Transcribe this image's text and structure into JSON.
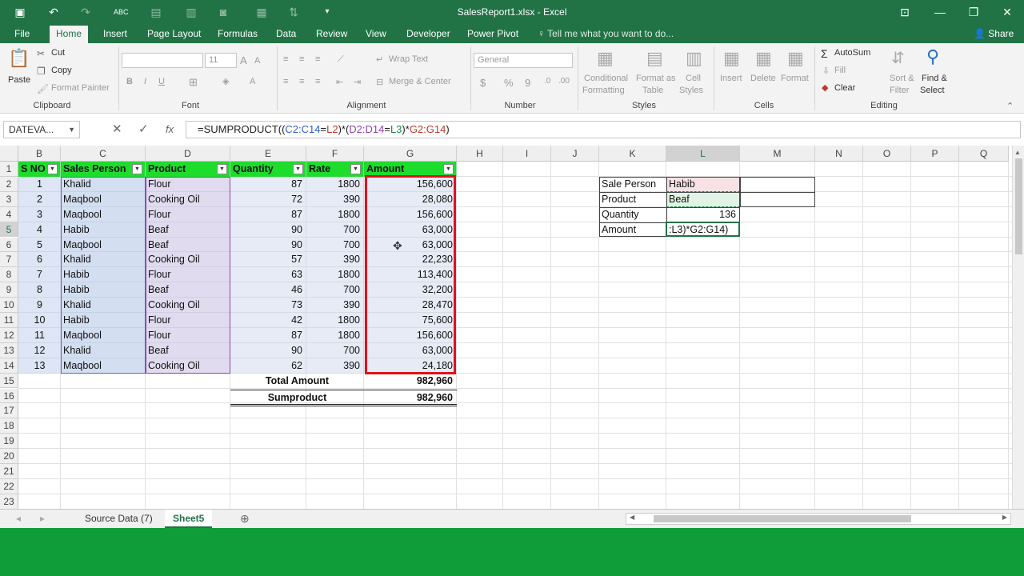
{
  "window": {
    "title": "SalesReport1.xlsx - Excel"
  },
  "tabs": [
    "File",
    "Home",
    "Insert",
    "Page Layout",
    "Formulas",
    "Data",
    "Review",
    "View",
    "Developer",
    "Power Pivot"
  ],
  "active_tab": "Home",
  "tell_me": "Tell me what you want to do...",
  "share": "Share",
  "ribbon": {
    "clipboard": {
      "paste": "Paste",
      "cut": "Cut",
      "copy": "Copy",
      "format_painter": "Format Painter",
      "label": "Clipboard"
    },
    "font": {
      "size": "11",
      "label": "Font"
    },
    "alignment": {
      "wrap": "Wrap Text",
      "merge": "Merge & Center",
      "label": "Alignment"
    },
    "number": {
      "format": "General",
      "label": "Number"
    },
    "styles": {
      "conditional": "Conditional",
      "conditional2": "Formatting",
      "format_as": "Format as",
      "format_as2": "Table",
      "cell": "Cell",
      "cell2": "Styles",
      "label": "Styles"
    },
    "cells": {
      "insert": "Insert",
      "delete": "Delete",
      "format": "Format",
      "label": "Cells"
    },
    "editing": {
      "autosum": "AutoSum",
      "fill": "Fill",
      "clear": "Clear",
      "sort": "Sort &",
      "sort2": "Filter",
      "find": "Find &",
      "find2": "Select",
      "label": "Editing"
    }
  },
  "formula_bar": {
    "name_box": "DATEVA...",
    "formula": "=SUMPRODUCT((C2:C14=L2)*(D2:D14=L3)*G2:G14)"
  },
  "columns": [
    "B",
    "C",
    "D",
    "E",
    "F",
    "G",
    "H",
    "I",
    "J",
    "K",
    "L",
    "M",
    "N",
    "O",
    "P",
    "Q"
  ],
  "rows": [
    "1",
    "2",
    "3",
    "4",
    "5",
    "6",
    "7",
    "8",
    "9",
    "10",
    "11",
    "12",
    "13",
    "14",
    "15",
    "16",
    "17",
    "18",
    "19",
    "20",
    "21",
    "22",
    "23"
  ],
  "table": {
    "headers": [
      "S NO",
      "Sales Person",
      "Product",
      "Quantity",
      "Rate",
      "Amount"
    ],
    "data": [
      [
        "1",
        "Khalid",
        "Flour",
        "87",
        "1800",
        "156,600"
      ],
      [
        "2",
        "Maqbool",
        "Cooking Oil",
        "72",
        "390",
        "28,080"
      ],
      [
        "3",
        "Maqbool",
        "Flour",
        "87",
        "1800",
        "156,600"
      ],
      [
        "4",
        "Habib",
        "Beaf",
        "90",
        "700",
        "63,000"
      ],
      [
        "5",
        "Maqbool",
        "Beaf",
        "90",
        "700",
        "63,000"
      ],
      [
        "6",
        "Khalid",
        "Cooking Oil",
        "57",
        "390",
        "22,230"
      ],
      [
        "7",
        "Habib",
        "Flour",
        "63",
        "1800",
        "113,400"
      ],
      [
        "8",
        "Habib",
        "Beaf",
        "46",
        "700",
        "32,200"
      ],
      [
        "9",
        "Khalid",
        "Cooking Oil",
        "73",
        "390",
        "28,470"
      ],
      [
        "10",
        "Habib",
        "Flour",
        "42",
        "1800",
        "75,600"
      ],
      [
        "11",
        "Maqbool",
        "Flour",
        "87",
        "1800",
        "156,600"
      ],
      [
        "12",
        "Khalid",
        "Beaf",
        "90",
        "700",
        "63,000"
      ],
      [
        "13",
        "Maqbool",
        "Cooking Oil",
        "62",
        "390",
        "24,180"
      ]
    ],
    "total_label": "Total Amount",
    "total_value": "982,960",
    "sumproduct_label": "Sumproduct",
    "sumproduct_value": "982,960"
  },
  "lookup": {
    "labels": [
      "Sale Person",
      "Product",
      "Quantity",
      "Amount"
    ],
    "values": [
      "Habib",
      "Beaf",
      "136",
      ":L3)*G2:G14)"
    ]
  },
  "sheets": [
    "Source Data (7)",
    "Sheet5"
  ],
  "active_sheet": "Sheet5",
  "colors": {
    "excel_green": "#217346",
    "header_green": "#1ddc2c",
    "selection_red": "#e0121b"
  }
}
